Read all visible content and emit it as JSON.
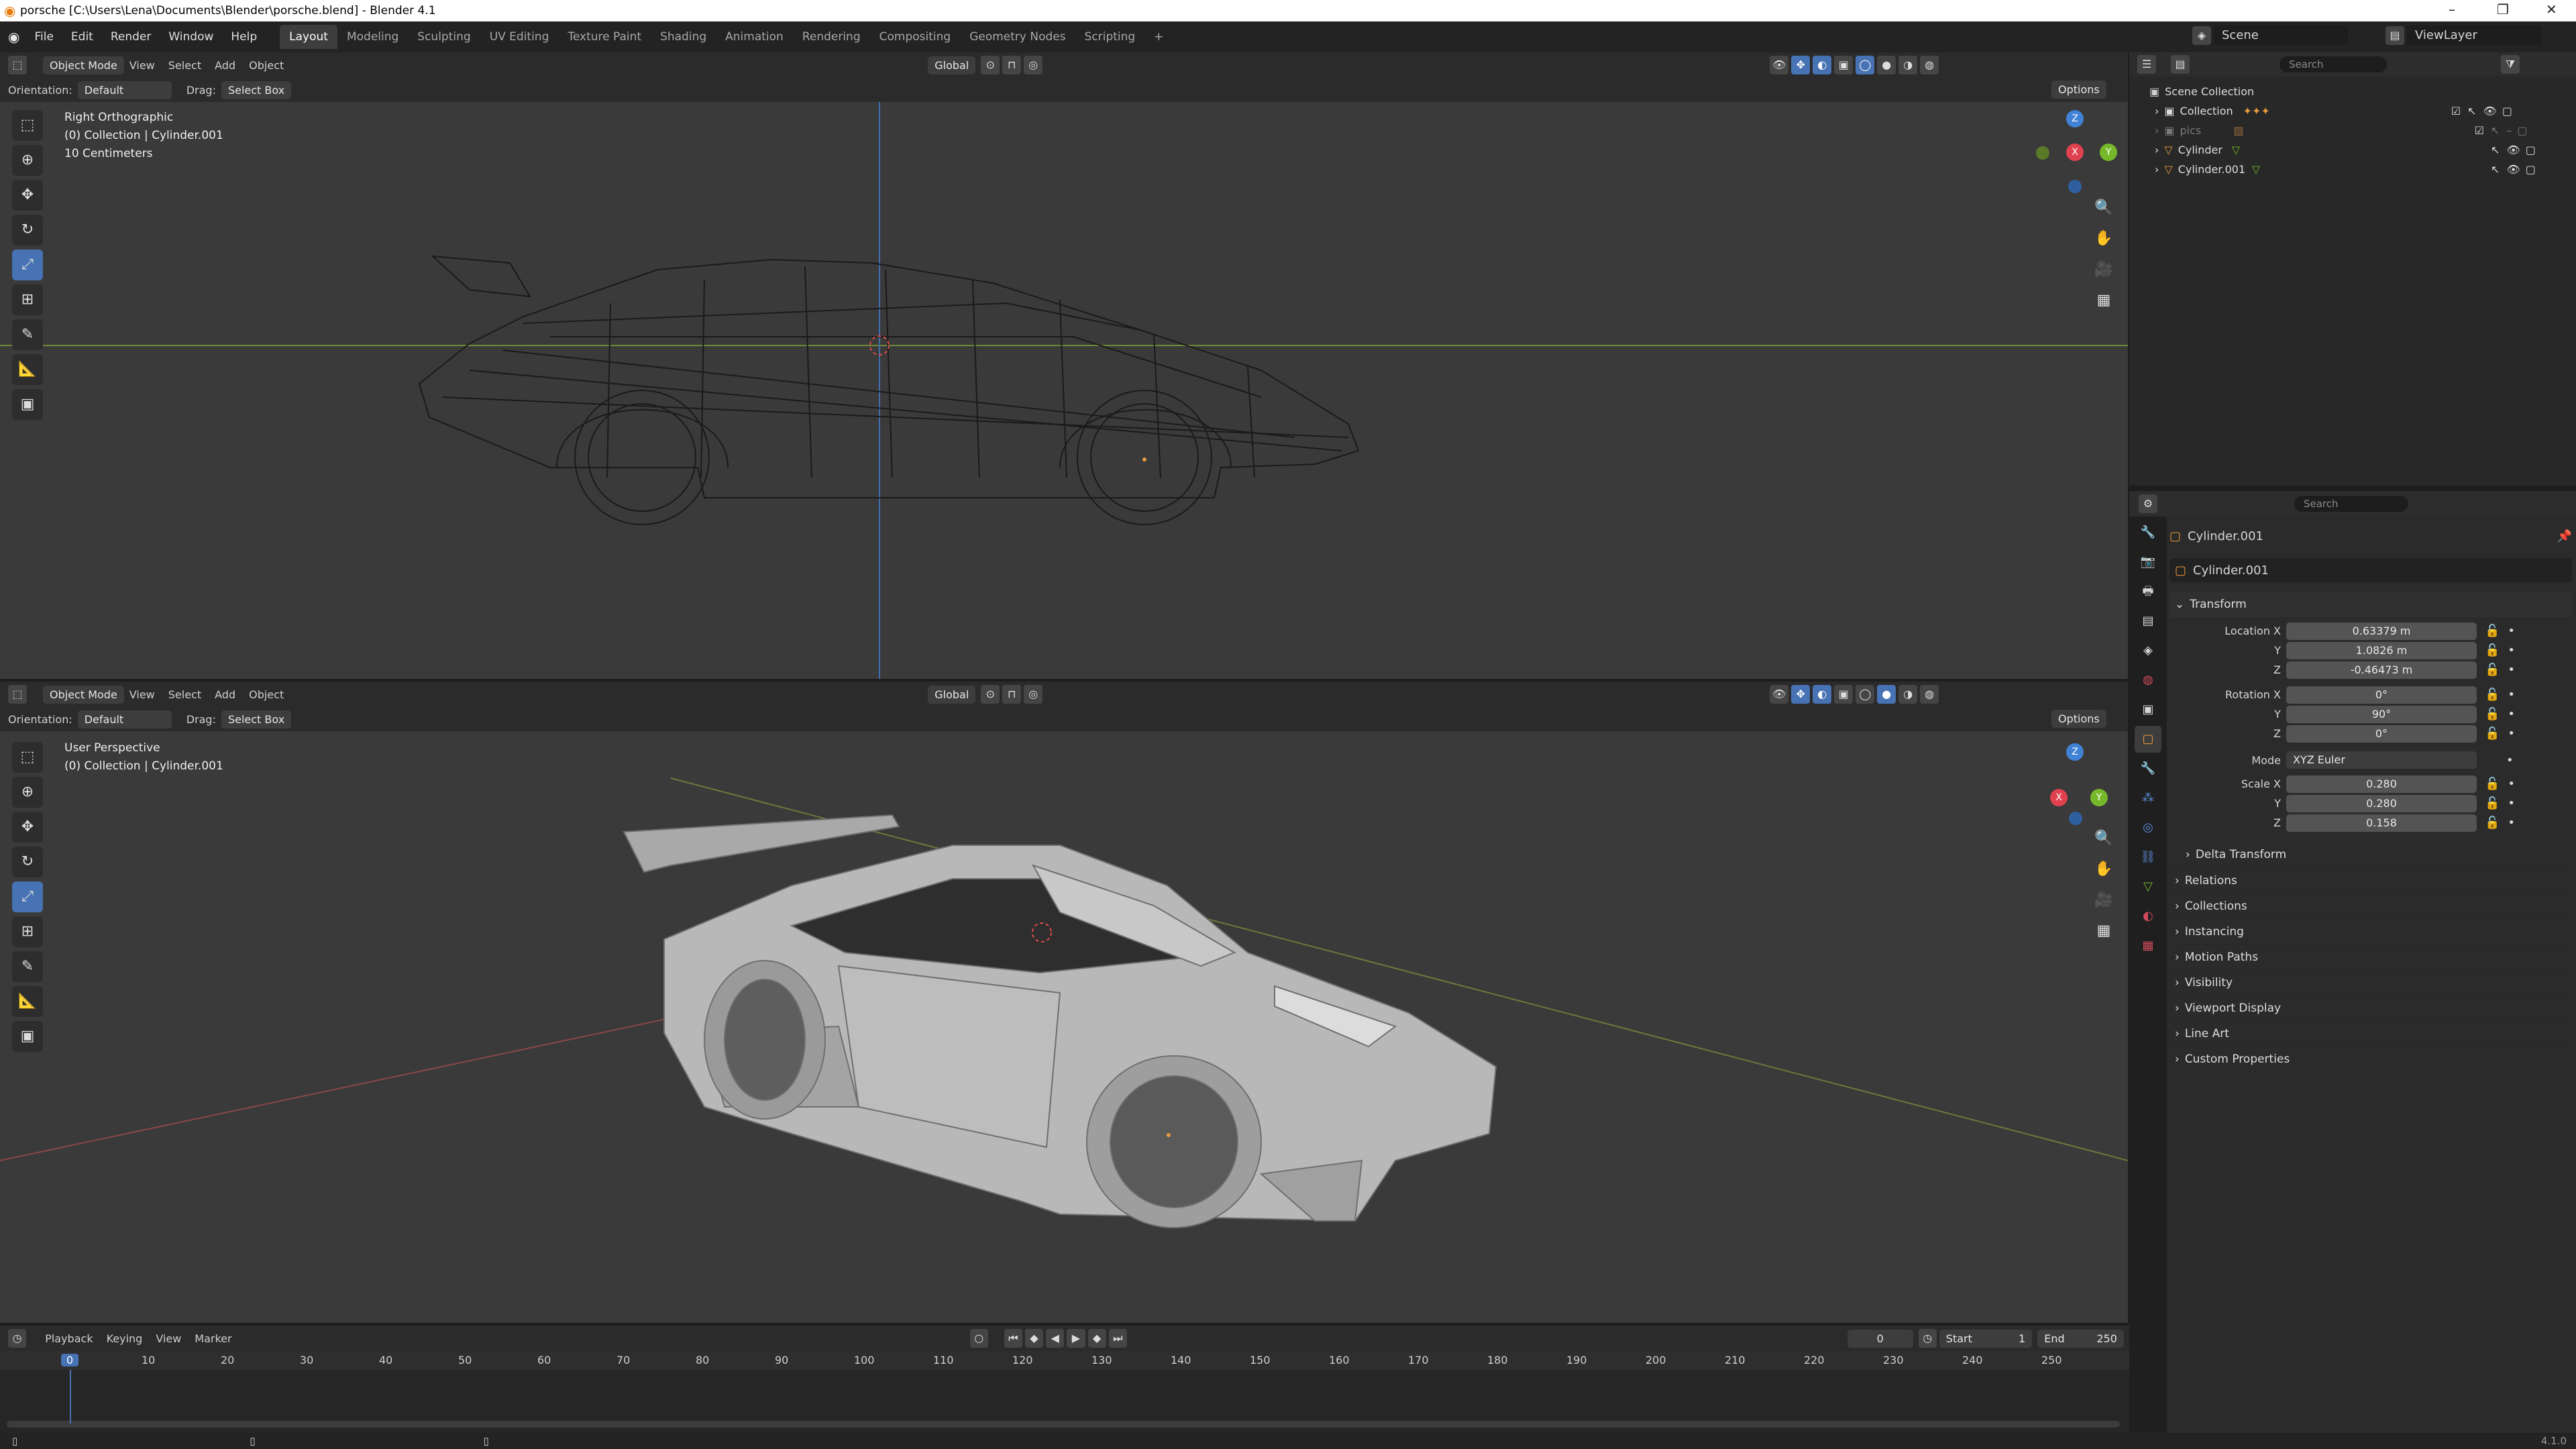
{
  "window": {
    "title": "porsche [C:\\Users\\Lena\\Documents\\Blender\\porsche.blend] - Blender 4.1"
  },
  "menu": [
    "File",
    "Edit",
    "Render",
    "Window",
    "Help"
  ],
  "workspaces": [
    "Layout",
    "Modeling",
    "Sculpting",
    "UV Editing",
    "Texture Paint",
    "Shading",
    "Animation",
    "Rendering",
    "Compositing",
    "Geometry Nodes",
    "Scripting"
  ],
  "top_right": {
    "scene": "Scene",
    "view_layer": "ViewLayer"
  },
  "header": {
    "mode": "Object Mode",
    "menus": [
      "View",
      "Select",
      "Add",
      "Object"
    ],
    "transform": "Global",
    "options": "Options",
    "orientation_label": "Orientation:",
    "orientation_value": "Default",
    "drag_label": "Drag:",
    "drag_value": "Select Box"
  },
  "viewport_top": {
    "line1": "Right Orthographic",
    "line2": "(0) Collection | Cylinder.001",
    "line3": "10 Centimeters"
  },
  "viewport_bottom": {
    "line1": "User Perspective",
    "line2": "(0) Collection | Cylinder.001"
  },
  "gizmo": {
    "x": "X",
    "y": "Y",
    "z": "Z"
  },
  "outliner": {
    "search_placeholder": "Search",
    "root": "Scene Collection",
    "items": [
      {
        "name": "Collection"
      },
      {
        "name": "pics"
      },
      {
        "name": "Cylinder"
      },
      {
        "name": "Cylinder.001"
      }
    ]
  },
  "properties": {
    "search_placeholder": "Search",
    "object_name": "Cylinder.001",
    "data_name": "Cylinder.001",
    "transform_title": "Transform",
    "location_label": "Location X",
    "location": {
      "x": "0.63379 m",
      "y": "1.0826 m",
      "z": "-0.46473 m"
    },
    "rotation_label": "Rotation X",
    "rotation": {
      "x": "0°",
      "y": "90°",
      "z": "0°"
    },
    "mode_label": "Mode",
    "mode_value": "XYZ Euler",
    "scale_label": "Scale X",
    "scale": {
      "x": "0.280",
      "y": "0.280",
      "z": "0.158"
    },
    "axis_y": "Y",
    "axis_z": "Z",
    "delta_transform": "Delta Transform",
    "panels": [
      "Relations",
      "Collections",
      "Instancing",
      "Motion Paths",
      "Visibility",
      "Viewport Display",
      "Line Art",
      "Custom Properties"
    ]
  },
  "timeline": {
    "menus": [
      "Playback",
      "Keying",
      "View",
      "Marker"
    ],
    "current_frame": "0",
    "start_label": "Start",
    "start": "1",
    "end_label": "End",
    "end": "250",
    "ticks": [
      "0",
      "10",
      "20",
      "30",
      "40",
      "50",
      "60",
      "70",
      "80",
      "90",
      "100",
      "110",
      "120",
      "130",
      "140",
      "150",
      "160",
      "170",
      "180",
      "190",
      "200",
      "210",
      "220",
      "230",
      "240",
      "250"
    ]
  },
  "status": {
    "version": "4.1.0"
  },
  "colors": {
    "accent": "#4772b3",
    "axis_x": "#e0414f",
    "axis_y": "#76b82a",
    "axis_z": "#3f82d6",
    "object_orange": "#e89a3c"
  }
}
